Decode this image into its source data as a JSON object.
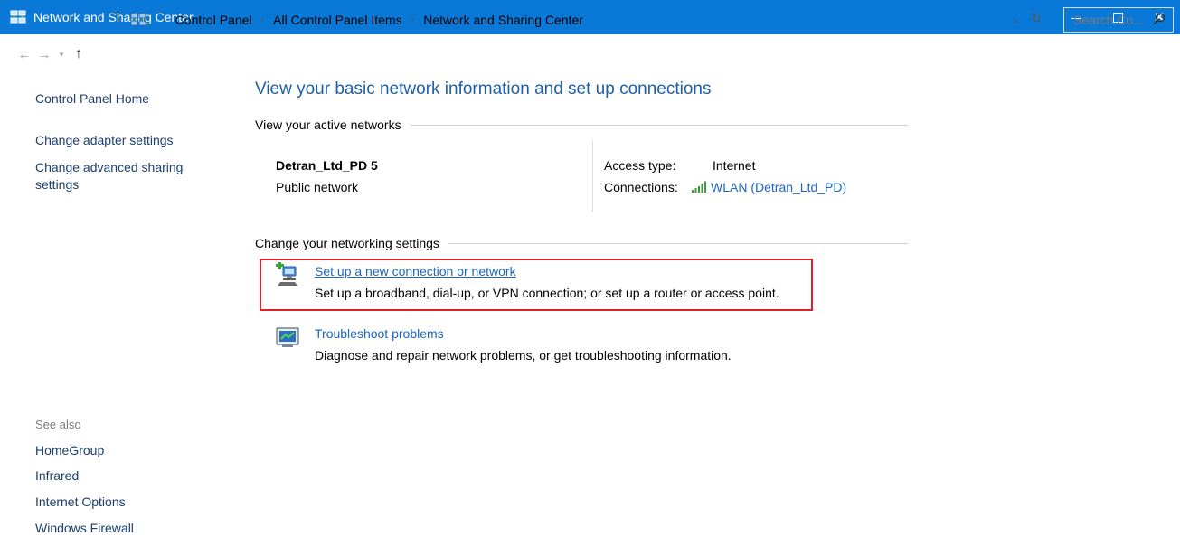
{
  "window": {
    "title": "Network and Sharing Center",
    "controls": {
      "minimize": "—",
      "maximize": "☐",
      "close": "✕"
    }
  },
  "address": {
    "breadcrumbs": [
      "Control Panel",
      "All Control Panel Items",
      "Network and Sharing Center"
    ],
    "search_placeholder": "Search Co..."
  },
  "sidebar": {
    "home": "Control Panel Home",
    "adapter": "Change adapter settings",
    "advanced": "Change advanced sharing settings",
    "see_also_label": "See also",
    "see_also": [
      "HomeGroup",
      "Infrared",
      "Internet Options",
      "Windows Firewall"
    ]
  },
  "main": {
    "title": "View your basic network information and set up connections",
    "active_networks_header": "View your active networks",
    "network": {
      "name": "Detran_Ltd_PD  5",
      "type": "Public network",
      "access_type_label": "Access type:",
      "access_type_value": "Internet",
      "connections_label": "Connections:",
      "connections_value": "WLAN (Detran_Ltd_PD)"
    },
    "change_settings_header": "Change your networking settings",
    "tasks": [
      {
        "link": "Set up a new connection or network",
        "desc": "Set up a broadband, dial-up, or VPN connection; or set up a router or access point."
      },
      {
        "link": "Troubleshoot problems",
        "desc": "Diagnose and repair network problems, or get troubleshooting information."
      }
    ]
  },
  "colors": {
    "titlebar": "#0a78d7",
    "link": "#1a66c1",
    "heading": "#1f5fa8",
    "highlight": "#e0212b"
  }
}
